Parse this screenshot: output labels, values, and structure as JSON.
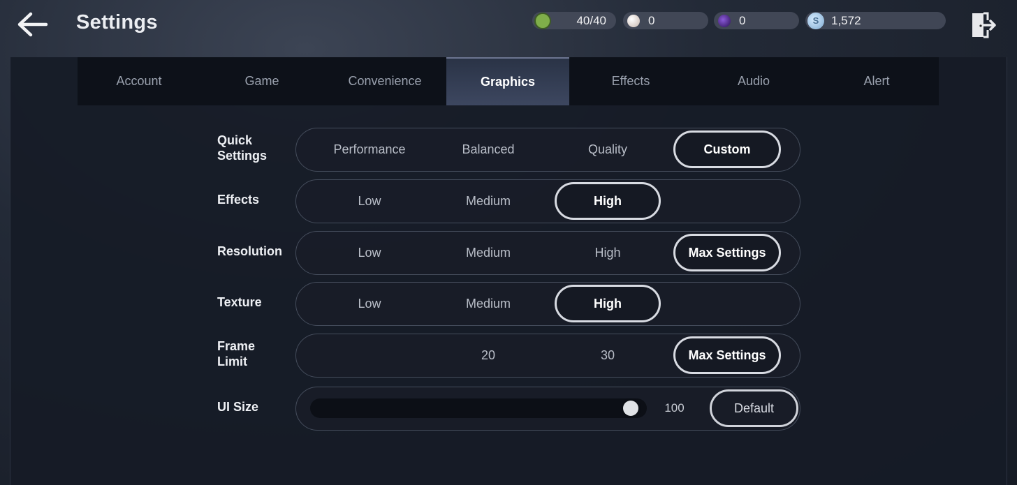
{
  "header": {
    "title": "Settings",
    "resources": [
      {
        "icon": "green-gem-icon",
        "value": "40/40",
        "color": "#7fae4a"
      },
      {
        "icon": "white-pearl-icon",
        "value": "0",
        "color": "#e6dcd6"
      },
      {
        "icon": "purple-orb-icon",
        "value": "0",
        "color": "#5a2ca0"
      },
      {
        "icon": "silver-coin-icon",
        "value": "1,572",
        "symbol": "S",
        "color": "#9fc6e8"
      }
    ]
  },
  "tabs": [
    {
      "label": "Account",
      "active": false
    },
    {
      "label": "Game",
      "active": false
    },
    {
      "label": "Convenience",
      "active": false
    },
    {
      "label": "Graphics",
      "active": true
    },
    {
      "label": "Effects",
      "active": false
    },
    {
      "label": "Audio",
      "active": false
    },
    {
      "label": "Alert",
      "active": false
    }
  ],
  "settings": {
    "quick": {
      "label_line1": "Quick",
      "label_line2": "Settings",
      "options": [
        "Performance",
        "Balanced",
        "Quality",
        "Custom"
      ],
      "selected": "Custom"
    },
    "effects": {
      "label": "Effects",
      "options": [
        "Low",
        "Medium",
        "High"
      ],
      "selected": "High"
    },
    "resolution": {
      "label": "Resolution",
      "options": [
        "Low",
        "Medium",
        "High",
        "Max Settings"
      ],
      "selected": "Max Settings"
    },
    "texture": {
      "label": "Texture",
      "options": [
        "Low",
        "Medium",
        "High"
      ],
      "selected": "High"
    },
    "frame_limit": {
      "label_line1": "Frame",
      "label_line2": "Limit",
      "options": [
        "20",
        "30",
        "Max Settings"
      ],
      "selected": "Max Settings"
    },
    "ui_size": {
      "label": "UI Size",
      "value": "100",
      "fraction": 0.98,
      "default_label": "Default"
    }
  }
}
